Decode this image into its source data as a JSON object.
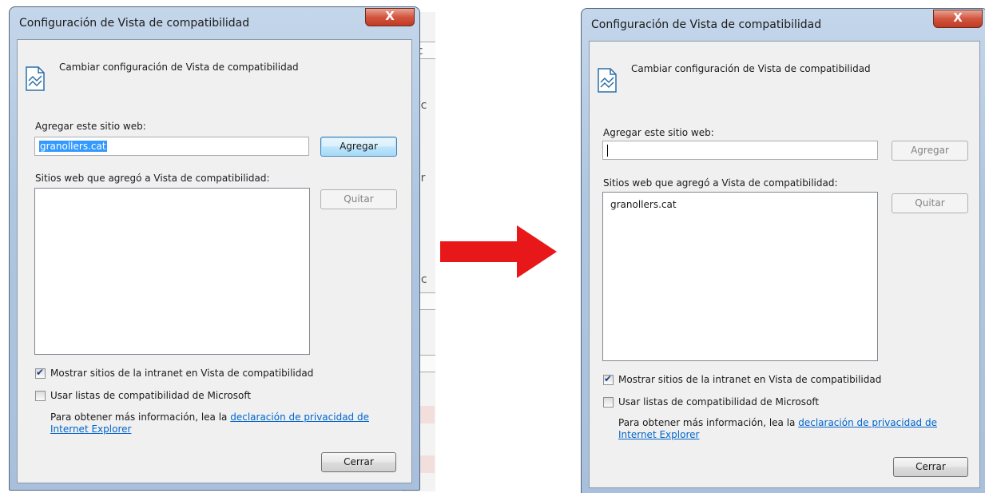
{
  "dialog_before": {
    "title": "Configuración de Vista de compatibilidad",
    "close_glyph": "X",
    "header_text": "Cambiar configuración de Vista de compatibilidad",
    "add_site_label": "Agregar este sitio web:",
    "add_site_value": "granollers.cat",
    "add_button": "Agregar",
    "list_label": "Sitios web que agregó a Vista de compatibilidad:",
    "list_items": [],
    "remove_button": "Quitar",
    "checkbox_intranet": "Mostrar sitios de la intranet en Vista de compatibilidad",
    "checkbox_intranet_checked": true,
    "checkbox_ms_lists": "Usar listas de compatibilidad de Microsoft",
    "checkbox_ms_lists_checked": false,
    "info_text": "Para obtener más información, lea la",
    "info_link": "declaración de privacidad de Internet Explorer",
    "close_button": "Cerrar"
  },
  "dialog_after": {
    "title": "Configuración de Vista de compatibilidad",
    "close_glyph": "X",
    "header_text": "Cambiar configuración de Vista de compatibilidad",
    "add_site_label": "Agregar este sitio web:",
    "add_site_value": "",
    "add_button": "Agregar",
    "list_label": "Sitios web que agregó a Vista de compatibilidad:",
    "list_items": [
      "granollers.cat"
    ],
    "remove_button": "Quitar",
    "checkbox_intranet": "Mostrar sitios de la intranet en Vista de compatibilidad",
    "checkbox_intranet_checked": true,
    "checkbox_ms_lists": "Usar listas de compatibilidad de Microsoft",
    "checkbox_ms_lists_checked": false,
    "info_text": "Para obtener más información, lea la",
    "info_link": "declaración de privacidad de Internet Explorer",
    "close_button": "Cerrar"
  },
  "background_fragments": [
    "ic",
    "ec",
    "l",
    "or",
    "o",
    "nc",
    "F",
    "f"
  ],
  "colors": {
    "arrow": "#e8181a",
    "link": "#0066cc",
    "selection": "#3399ff",
    "close_button": "#c7432b"
  },
  "icons": {
    "header": "page-icon",
    "transition": "right-arrow-icon"
  }
}
